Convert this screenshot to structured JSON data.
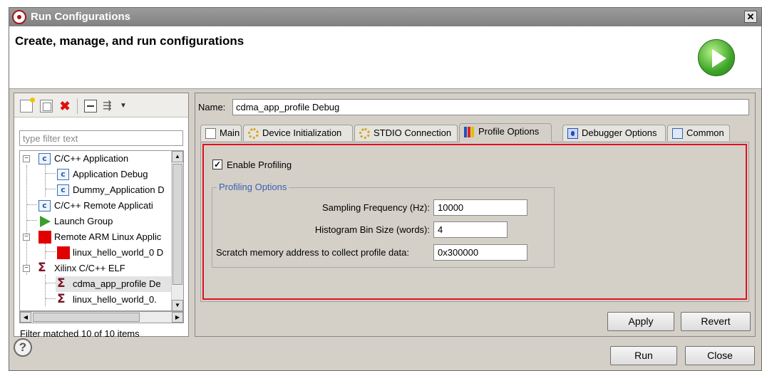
{
  "window": {
    "title": "Run Configurations",
    "close_glyph": "✕"
  },
  "header": {
    "heading": "Create, manage, and run configurations",
    "icon": "run-icon"
  },
  "left": {
    "toolbar": [
      "new-config-icon",
      "duplicate-icon",
      "delete-icon",
      "collapse-all-icon",
      "filter-icon",
      "view-menu-icon"
    ],
    "filter_placeholder": "type filter text",
    "tree": [
      {
        "label": "C/C++ Application",
        "icon": "c-icon",
        "expander": "−"
      },
      {
        "label": "Application Debug",
        "icon": "c-icon"
      },
      {
        "label": "Dummy_Application D",
        "icon": "c-icon"
      },
      {
        "label": "C/C++ Remote Applicati",
        "icon": "c-icon"
      },
      {
        "label": "Launch Group",
        "icon": "launch-icon"
      },
      {
        "label": "Remote ARM Linux Applic",
        "icon": "red-square-icon",
        "expander": "−"
      },
      {
        "label": "linux_hello_world_0 D",
        "icon": "red-square-icon"
      },
      {
        "label": "Xilinx C/C++ ELF",
        "icon": "xilinx-icon",
        "expander": "−"
      },
      {
        "label": "cdma_app_profile De",
        "icon": "xilinx-icon",
        "selected": true
      },
      {
        "label": "linux_hello_world_0.",
        "icon": "xilinx-icon"
      }
    ],
    "status": "Filter matched 10 of 10 items"
  },
  "right": {
    "name_label": "Name:",
    "name_value": "cdma_app_profile Debug",
    "tabs": [
      {
        "label": "Main",
        "icon": "doc-icon"
      },
      {
        "label": "Device Initialization",
        "icon": "gear-icon"
      },
      {
        "label": "STDIO Connection",
        "icon": "gear-icon"
      },
      {
        "label": "Profile Options",
        "icon": "chart-icon",
        "active": true
      },
      {
        "label": "Debugger Options",
        "icon": "bug-icon"
      },
      {
        "label": "Common",
        "icon": "common-icon"
      }
    ],
    "enable_profiling": {
      "label": "Enable Profiling",
      "checked": true,
      "mark": "✓"
    },
    "group_title": "Profiling Options",
    "fields": [
      {
        "label": "Sampling Frequency (Hz):",
        "value": "10000"
      },
      {
        "label": "Histogram Bin Size (words):",
        "value": "4"
      },
      {
        "label": "Scratch memory address to collect profile data:",
        "value": "0x300000"
      }
    ],
    "apply": "Apply",
    "revert": "Revert"
  },
  "footer": {
    "help": "?",
    "run": "Run",
    "close": "Close"
  },
  "colors": {
    "highlight": "#e01020",
    "group_title": "#3a60b0",
    "dialog_bg": "#d4d0c8"
  }
}
